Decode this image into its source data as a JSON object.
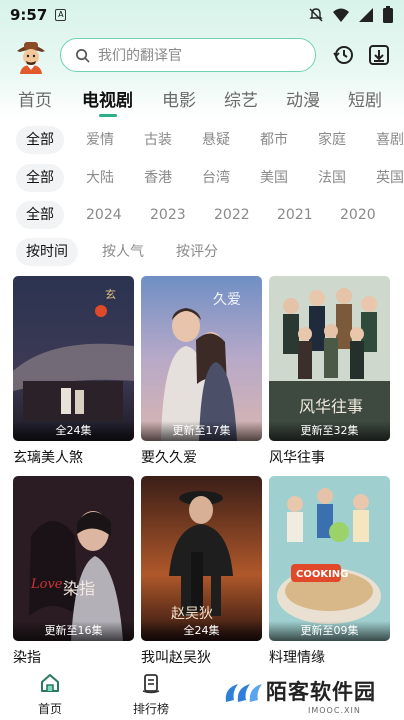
{
  "status": {
    "time": "9:57"
  },
  "header": {
    "search_placeholder": "我们的翻译官"
  },
  "tabs": [
    {
      "label": "首页"
    },
    {
      "label": "电视剧"
    },
    {
      "label": "电影"
    },
    {
      "label": "综艺"
    },
    {
      "label": "动漫"
    },
    {
      "label": "短剧"
    }
  ],
  "active_tab": "电视剧",
  "filters": [
    {
      "items": [
        "全部",
        "爱情",
        "古装",
        "悬疑",
        "都市",
        "家庭",
        "喜剧"
      ]
    },
    {
      "items": [
        "全部",
        "大陆",
        "香港",
        "台湾",
        "美国",
        "法国",
        "英国"
      ]
    },
    {
      "items": [
        "全部",
        "2024",
        "2023",
        "2022",
        "2021",
        "2020"
      ]
    },
    {
      "items": [
        "按时间",
        "按人气",
        "按评分"
      ]
    }
  ],
  "shows": [
    {
      "title": "玄璃美人煞",
      "badge": "全24集"
    },
    {
      "title": "要久久爱",
      "badge": "更新至17集"
    },
    {
      "title": "风华往事",
      "badge": "更新至32集"
    },
    {
      "title": "染指",
      "badge": "更新至16集"
    },
    {
      "title": "我叫赵吴狄",
      "badge": "全24集"
    },
    {
      "title": "料理情缘",
      "badge": "更新至09集"
    }
  ],
  "bottom_nav": [
    {
      "label": "首页",
      "icon": "home-icon"
    },
    {
      "label": "排行榜",
      "icon": "ranking-icon"
    }
  ],
  "watermark": {
    "name": "陌客软件园",
    "domain": "IMOOC.XIN"
  },
  "colors": {
    "accent": "#2bb08a",
    "header_bg": "#d8f3ea"
  }
}
